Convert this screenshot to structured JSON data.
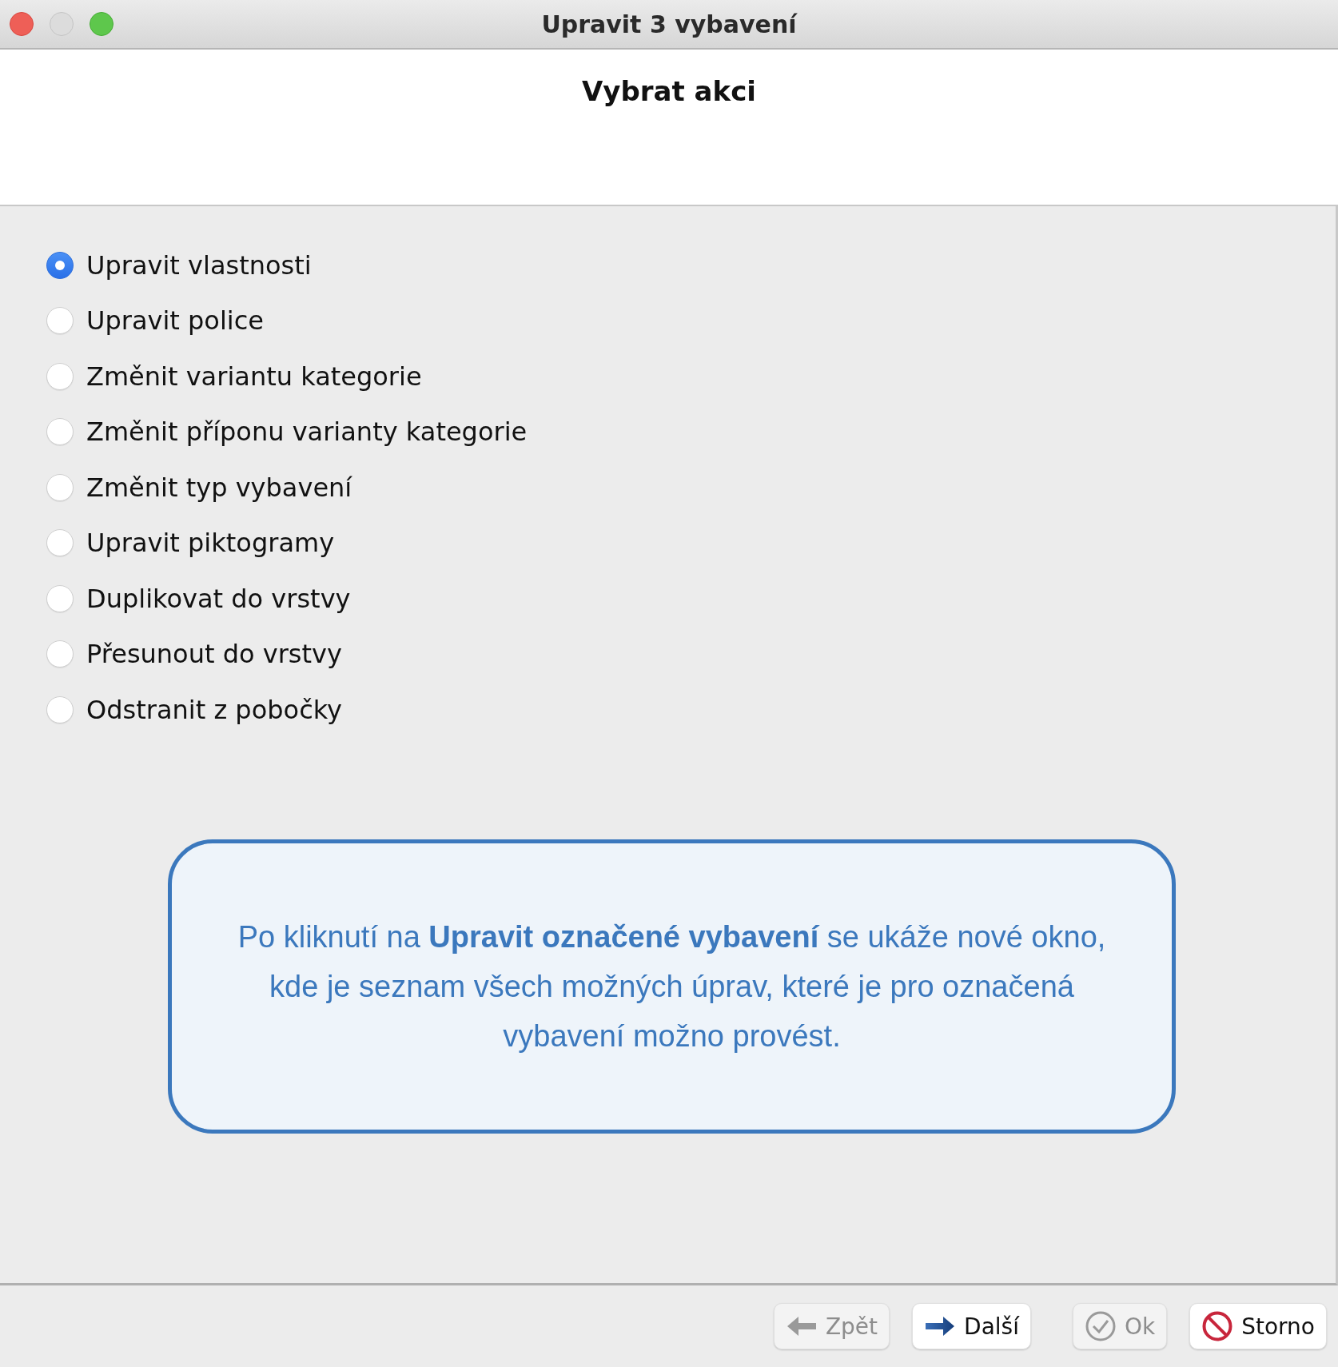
{
  "window": {
    "title": "Upravit 3 vybavení"
  },
  "header": {
    "title": "Vybrat akci"
  },
  "options": [
    {
      "label": "Upravit vlastnosti",
      "selected": true
    },
    {
      "label": "Upravit police",
      "selected": false
    },
    {
      "label": "Změnit variantu kategorie",
      "selected": false
    },
    {
      "label": "Změnit příponu varianty kategorie",
      "selected": false
    },
    {
      "label": "Změnit typ vybavení",
      "selected": false
    },
    {
      "label": "Upravit piktogramy",
      "selected": false
    },
    {
      "label": "Duplikovat do vrstvy",
      "selected": false
    },
    {
      "label": "Přesunout do vrstvy",
      "selected": false
    },
    {
      "label": "Odstranit z pobočky",
      "selected": false
    }
  ],
  "callout": {
    "text": "Po kliknutí na **Upravit označené vybavení** se ukáže nové okno, kde je seznam všech možných úprav, které je pro označená vybavení možno provést."
  },
  "buttons": [
    {
      "kind": "back",
      "label": "Zpět",
      "disabled": true
    },
    {
      "kind": "next",
      "label": "Další",
      "disabled": false
    },
    {
      "kind": "ok",
      "label": "Ok",
      "disabled": true
    },
    {
      "kind": "cancel",
      "label": "Storno",
      "disabled": false
    }
  ]
}
